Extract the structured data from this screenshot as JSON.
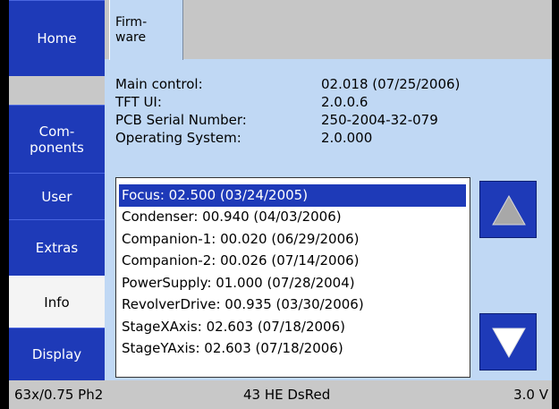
{
  "sidebar": {
    "items": [
      {
        "label": "Home"
      },
      {
        "label": "Com-\nponents"
      },
      {
        "label": "User"
      },
      {
        "label": "Extras"
      },
      {
        "label": "Info"
      },
      {
        "label": "Display"
      }
    ]
  },
  "tab": {
    "label": "Firm-\nware"
  },
  "info": {
    "rows": [
      {
        "key": "Main control:",
        "value": "02.018 (07/25/2006)"
      },
      {
        "key": "TFT UI:",
        "value": "2.0.0.6"
      },
      {
        "key": "PCB Serial Number:",
        "value": "250-2004-32-079"
      },
      {
        "key": "Operating System:",
        "value": "2.0.000"
      }
    ]
  },
  "firmware_list": [
    "Focus: 02.500 (03/24/2005)",
    "Condenser: 00.940 (04/03/2006)",
    "Companion-1: 00.020 (06/29/2006)",
    "Companion-2: 00.026 (07/14/2006)",
    "PowerSupply: 01.000 (07/28/2004)",
    "RevolverDrive: 00.935 (03/30/2006)",
    "StageXAxis: 02.603 (07/18/2006)",
    "StageYAxis: 02.603 (07/18/2006)"
  ],
  "selected_item": "Focus: 02.500 (03/24/2005)",
  "status": {
    "left": "63x/0.75 Ph2",
    "center": "43 HE DsRed",
    "right": "3.0 V"
  },
  "icons": {
    "scroll_up": "triangle-up-icon",
    "scroll_down": "triangle-down-icon"
  },
  "colors": {
    "nav_blue": "#1e3ab8",
    "panel_bg": "#c0d8f4",
    "selected_bg": "#1e3ab8"
  }
}
